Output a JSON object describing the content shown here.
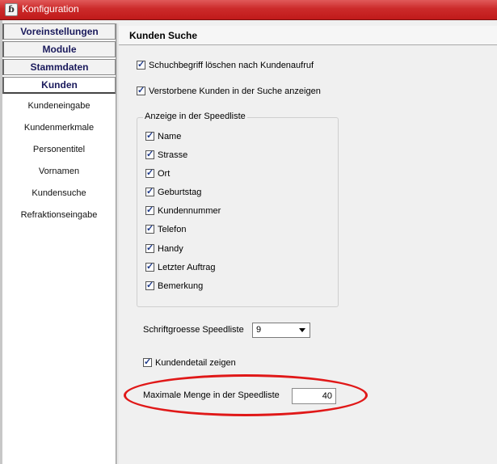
{
  "window": {
    "title": "Konfiguration",
    "icon": "app-logo-icon"
  },
  "sidebar": {
    "headers": [
      {
        "label": "Voreinstellungen"
      },
      {
        "label": "Module"
      },
      {
        "label": "Stammdaten"
      },
      {
        "label": "Kunden"
      }
    ],
    "items": [
      {
        "label": "Kundeneingabe"
      },
      {
        "label": "Kundenmerkmale"
      },
      {
        "label": "Personentitel"
      },
      {
        "label": "Vornamen"
      },
      {
        "label": "Kundensuche"
      },
      {
        "label": "Refraktionseingabe"
      }
    ]
  },
  "main": {
    "title": "Kunden Suche",
    "options": [
      {
        "label": "Schuchbegriff löschen nach Kundenaufruf",
        "checked": true
      },
      {
        "label": "Verstorbene Kunden in der Suche anzeigen",
        "checked": true
      }
    ],
    "speedlist_group": {
      "title": "Anzeige in der Speedliste",
      "fields": [
        {
          "label": "Name",
          "checked": true
        },
        {
          "label": "Strasse",
          "checked": true
        },
        {
          "label": "Ort",
          "checked": true
        },
        {
          "label": "Geburtstag",
          "checked": true
        },
        {
          "label": "Kundennummer",
          "checked": true
        },
        {
          "label": "Telefon",
          "checked": true
        },
        {
          "label": "Handy",
          "checked": true
        },
        {
          "label": "Letzter Auftrag",
          "checked": true
        },
        {
          "label": "Bemerkung",
          "checked": true
        }
      ]
    },
    "font_size": {
      "label": "Schriftgroesse Speedliste",
      "value": "9"
    },
    "kundendetail": {
      "label": "Kundendetail zeigen",
      "checked": true
    },
    "max_amount": {
      "label": "Maximale Menge in der Speedliste",
      "value": "40"
    }
  },
  "colors": {
    "titlebar": "#cc2a2a",
    "highlight": "#e01818",
    "nav_header_text": "#1a1a5c"
  }
}
